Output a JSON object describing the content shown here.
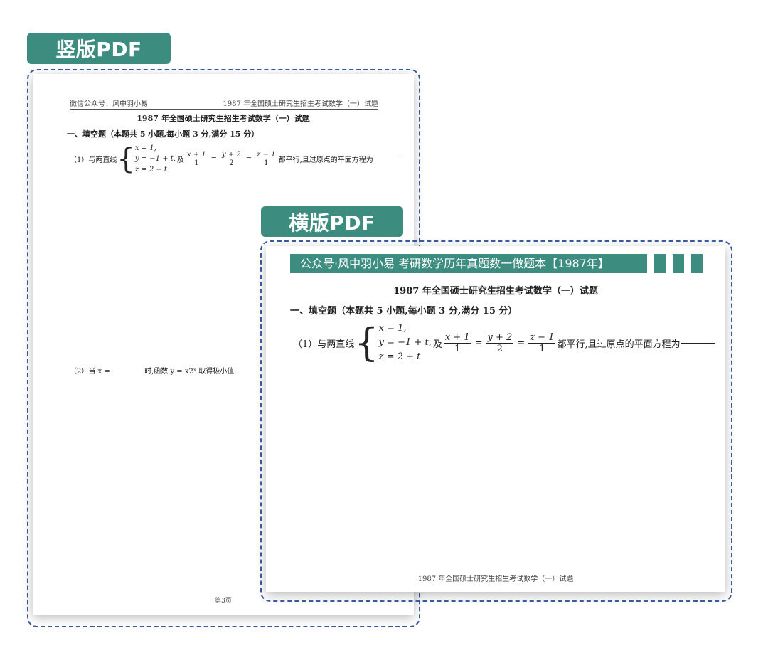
{
  "labels": {
    "portrait": "竖版PDF",
    "landscape": "横版PDF"
  },
  "portrait_page": {
    "header_left": "微信公众号：风中羽小易",
    "header_right": "1987 年全国硕士研究生招生考试数学（一）试题",
    "title": "1987 年全国硕士研究生招生考试数学（一）试题",
    "section": "一、填空题（本题共 5 小题,每小题 3 分,满分 15 分）",
    "q1_prefix": "（1）与两直线",
    "sys1": "x = 1,",
    "sys2": "y = −1 + t,",
    "sys3": "z = 2 + t",
    "mid_text": "及",
    "f1_num": "x + 1",
    "f1_den": "1",
    "f2_num": "y + 2",
    "f2_den": "2",
    "f3_num": "z − 1",
    "f3_den": "1",
    "q1_suffix": "都平行,且过原点的平面方程为",
    "q2_prefix": "（2）当 x =",
    "q2_suffix": "时,函数 y = x2ˣ 取得极小值.",
    "footer": "第3页"
  },
  "landscape_page": {
    "banner": "公众号·风中羽小易 考研数学历年真题数一做题本【1987年】",
    "title": "1987 年全国硕士研究生招生考试数学（一）试题",
    "section": "一、填空题（本题共 5 小题,每小题 3 分,满分 15 分）",
    "q1_prefix": "（1）与两直线",
    "sys1": "x = 1,",
    "sys2": "y = −1 + t,",
    "sys3": "z = 2 + t",
    "mid_text": "及",
    "f1_num": "x + 1",
    "f1_den": "1",
    "f2_num": "y + 2",
    "f2_den": "2",
    "f3_num": "z − 1",
    "f3_den": "1",
    "q1_suffix": "都平行,且过原点的平面方程为",
    "footer": "1987 年全国硕士研究生招生考试数学（一）试题"
  },
  "colors": {
    "accent": "#3c8c80",
    "frame": "#3a58a0"
  }
}
